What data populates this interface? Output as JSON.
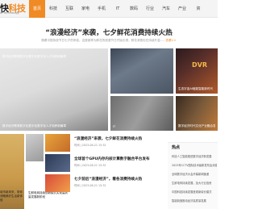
{
  "logo": {
    "text_main": "快",
    "text_accent": "科技",
    "subtitle": "ai Technology"
  },
  "nav": {
    "items": [
      {
        "label": "首页",
        "active": true
      },
      {
        "label": "科技"
      },
      {
        "label": "互联"
      },
      {
        "label": "家电"
      },
      {
        "label": "手机"
      },
      {
        "label": "IT"
      },
      {
        "label": "数码"
      },
      {
        "label": "行业"
      },
      {
        "label": "汽车"
      },
      {
        "label": "产业"
      },
      {
        "label": "资"
      }
    ]
  },
  "headline": {
    "title": "“浪漫经济”来袭，七夕鲜花消费持续火热",
    "summary": "随着中国传统节日七夕的来临，这座被称为鲜花的浪漫节日开始引燃，鲜花消费也在持续升温......",
    "more": "查看>>"
  },
  "features": {
    "left_top_caption": "数字经济教育数字化数字化数字化人才培养新篇章",
    "left_caption": "数字经济教育数字化数字化数字化人才培养新篇章",
    "small_1_caption": "",
    "small_2_caption": "生态宇宙AI赋能智能新时代",
    "small_2_graphic": "DVR",
    "small_3_caption": "IT",
    "small_4_caption": "数字经济时代文化产业融合发展"
  },
  "lower": {
    "side_caption": "城市新风采，带你领略美好生活新体验",
    "mid_caption": "生鲜电商持续创新模式实现高质量发展新阶段",
    "list": [
      {
        "title": "“浪漫经济”来袭，七夕鲜花消费持续火热",
        "meta": "时间 | 2023-08-21 15:32"
      },
      {
        "title": "全球首个GPU内存内核计算数字融合平台发布",
        "meta": "时间 | 2023-08-21 15:32"
      },
      {
        "title": "七夕前后“浪漫经济”，看各消费持续火热",
        "meta": "时间 | 2023-08-21 15:32"
      }
    ]
  },
  "hot": {
    "title": "热点",
    "items": [
      "科技人工智能推进数字经济新发展",
      "2023年CCTV国际技术最新发布会消息",
      "全球数字经济大会开幕新闻速递",
      "生鲜电商持续发展，加大行业投资",
      "中国科技持续发展呈现新增长模式",
      "智能制造推动经济高质量发展"
    ]
  },
  "colors": {
    "accent": "#f08a24",
    "nav_bg": "#f4f4f4"
  }
}
